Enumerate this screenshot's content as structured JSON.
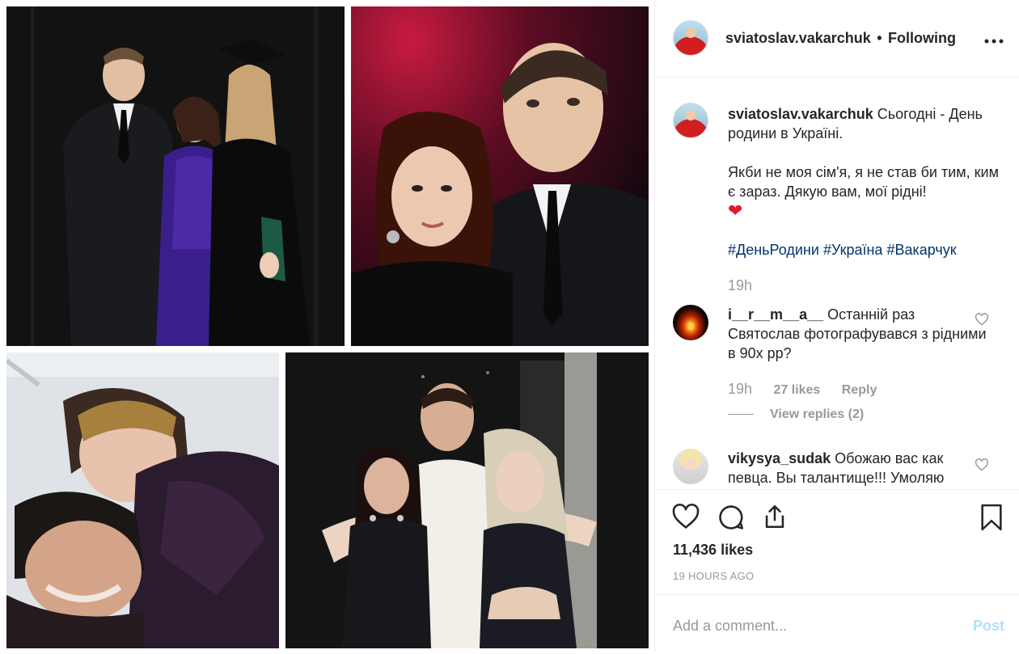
{
  "header": {
    "username": "sviatoslav.vakarchuk",
    "separator": "•",
    "follow_status": "Following",
    "more_glyph": "•••"
  },
  "caption": {
    "username": "sviatoslav.vakarchuk",
    "line1": "Сьогодні - День родини в Україні.",
    "line2": "Якби не моя сім'я, я не став би тим, ким є зараз. Дякую вам, мої рідні!",
    "emoji": "❤",
    "hashtags": [
      "#ДеньРодини",
      "#Україна",
      "#Вакарчук"
    ],
    "time": "19h"
  },
  "comments": [
    {
      "username": "i__r__m__a__",
      "text": "Останній раз Святослав фотографувався з рідними в 90х рр?",
      "time": "19h",
      "likes": "27 likes",
      "reply": "Reply",
      "view_replies": "View replies (2)"
    },
    {
      "username": "vikysya_sudak",
      "text": "Обожаю вас как певца. Вы талантище!!! Умоляю"
    }
  ],
  "actions": {
    "likes": "11,436 likes",
    "posted": "19 HOURS AGO"
  },
  "comment_box": {
    "placeholder": "Add a comment...",
    "post_label": "Post"
  },
  "icons": {
    "like": "heart-outline-icon",
    "comment": "speech-bubble-icon",
    "share": "share-icon",
    "save": "bookmark-icon",
    "comment_like": "small-heart-icon"
  },
  "colors": {
    "hashtag": "#003569",
    "muted": "#999999",
    "post_disabled": "#b2dffc",
    "heart_emoji": "#e0192b"
  }
}
